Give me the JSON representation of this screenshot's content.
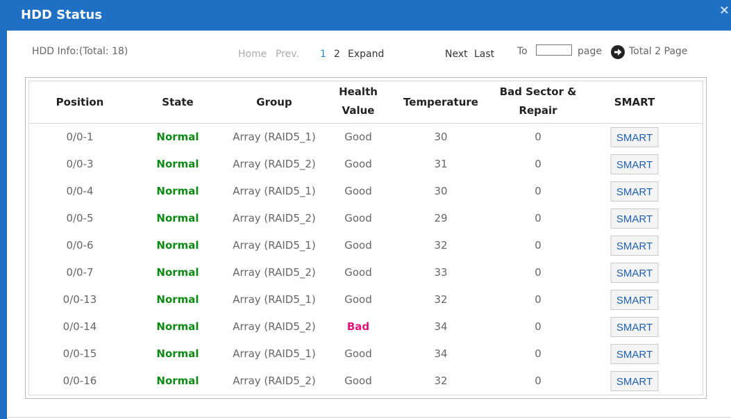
{
  "window": {
    "title": "HDD Status",
    "close_glyph": "×"
  },
  "info": {
    "hdd_info": "HDD Info:(Total: 18)",
    "nav": {
      "home": "Home",
      "prev": "Prev.",
      "page1": "1",
      "page2": "2",
      "expand": "Expand",
      "next": "Next",
      "last": "Last"
    },
    "goto": {
      "to": "To",
      "value": "",
      "page": "page",
      "total": "Total 2 Page"
    }
  },
  "table": {
    "headers": {
      "position": "Position",
      "state": "State",
      "group": "Group",
      "health_l1": "Health",
      "health_l2": "Value",
      "temperature": "Temperature",
      "bad_l1": "Bad Sector &",
      "bad_l2": "Repair",
      "smart": "SMART"
    },
    "rows": [
      {
        "position": "0/0-1",
        "state": "Normal",
        "group": "Array (RAID5_1)",
        "health": "Good",
        "temperature": "30",
        "bad_sector": "0",
        "smart": "SMART"
      },
      {
        "position": "0/0-3",
        "state": "Normal",
        "group": "Array (RAID5_2)",
        "health": "Good",
        "temperature": "31",
        "bad_sector": "0",
        "smart": "SMART"
      },
      {
        "position": "0/0-4",
        "state": "Normal",
        "group": "Array (RAID5_1)",
        "health": "Good",
        "temperature": "30",
        "bad_sector": "0",
        "smart": "SMART"
      },
      {
        "position": "0/0-5",
        "state": "Normal",
        "group": "Array (RAID5_2)",
        "health": "Good",
        "temperature": "29",
        "bad_sector": "0",
        "smart": "SMART"
      },
      {
        "position": "0/0-6",
        "state": "Normal",
        "group": "Array (RAID5_1)",
        "health": "Good",
        "temperature": "32",
        "bad_sector": "0",
        "smart": "SMART"
      },
      {
        "position": "0/0-7",
        "state": "Normal",
        "group": "Array (RAID5_2)",
        "health": "Good",
        "temperature": "33",
        "bad_sector": "0",
        "smart": "SMART"
      },
      {
        "position": "0/0-13",
        "state": "Normal",
        "group": "Array (RAID5_1)",
        "health": "Good",
        "temperature": "32",
        "bad_sector": "0",
        "smart": "SMART"
      },
      {
        "position": "0/0-14",
        "state": "Normal",
        "group": "Array (RAID5_2)",
        "health": "Bad",
        "temperature": "34",
        "bad_sector": "0",
        "smart": "SMART"
      },
      {
        "position": "0/0-15",
        "state": "Normal",
        "group": "Array (RAID5_1)",
        "health": "Good",
        "temperature": "34",
        "bad_sector": "0",
        "smart": "SMART"
      },
      {
        "position": "0/0-16",
        "state": "Normal",
        "group": "Array (RAID5_2)",
        "health": "Good",
        "temperature": "32",
        "bad_sector": "0",
        "smart": "SMART"
      }
    ]
  },
  "colors": {
    "titlebar": "#1f6fc5",
    "state_normal": "#0d8a14",
    "health_bad": "#e0137c",
    "current_page": "#1a8bc7",
    "smart_text": "#1f5fb0"
  },
  "icons": {
    "close": "close-icon",
    "goto": "arrow-right-circle-icon"
  }
}
